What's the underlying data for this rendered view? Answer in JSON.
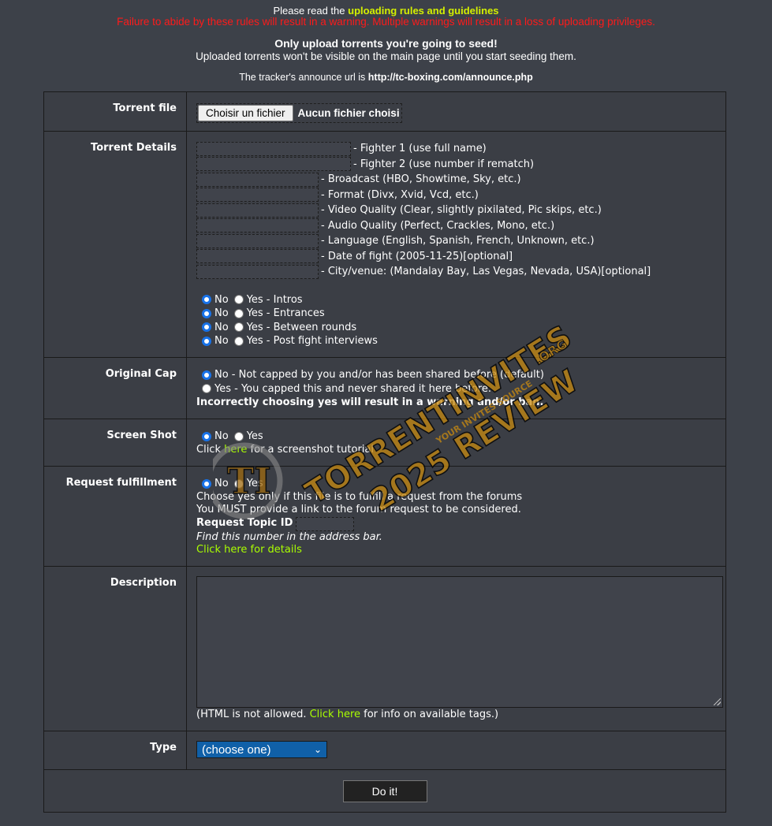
{
  "header": {
    "rules_prefix": "Please read the ",
    "rules_link": "uploading rules and guidelines",
    "warning": "Failure to abide by these rules will result in a warning. Multiple warnings will result in a loss of uploading privileges.",
    "seed_title": "Only upload torrents you're going to seed!",
    "seed_sub": "Uploaded torrents won't be visible on the main page until you start seeding them.",
    "announce_prefix": "The tracker's announce url is ",
    "announce_url": "http://tc-boxing.com/announce.php"
  },
  "torrent_file": {
    "label": "Torrent file",
    "button": "Choisir un fichier",
    "status": "Aucun fichier choisi"
  },
  "details": {
    "label": "Torrent Details",
    "fields": [
      "- Fighter 1 (use full name)",
      "- Fighter 2 (use number if rematch)",
      "- Broadcast (HBO, Showtime, Sky, etc.)",
      "- Format (Divx, Xvid, Vcd, etc.)",
      "- Video Quality (Clear, slightly pixilated, Pic skips, etc.)",
      "- Audio Quality (Perfect, Crackles, Mono, etc.)",
      "- Language (English, Spanish, French, Unknown, etc.)",
      "- Date of fight (2005-11-25)[optional]",
      "- City/venue: (Mandalay Bay, Las Vegas, Nevada, USA)[optional]"
    ],
    "no": "No",
    "yes_items": [
      "Yes - Intros",
      "Yes - Entrances",
      "Yes - Between rounds",
      "Yes - Post fight interviews"
    ]
  },
  "original_cap": {
    "label": "Original Cap",
    "no_text": "No - Not capped by you and/or has been shared before (default)",
    "yes_text": "Yes - You capped this and never shared it here before.",
    "note": "Incorrectly choosing yes will result in a warning and/or ban."
  },
  "screen_shot": {
    "label": "Screen Shot",
    "no": "No",
    "yes": "Yes",
    "click": "Click ",
    "here": "here",
    "rest": " for a screenshot tutorial"
  },
  "request": {
    "label": "Request fulfillment",
    "no": "No",
    "yes": "Yes",
    "line1": "Choose yes only if this file is to fulfill a request from the forums",
    "line2": "You MUST provide a link to the forum request to be considered.",
    "topic_label": "Request Topic ID",
    "hint": "Find this number in the address bar.",
    "details_link": "Click here for details"
  },
  "description": {
    "label": "Description",
    "note_prefix": "(HTML is not allowed. ",
    "note_link": "Click here",
    "note_suffix": " for info on available tags.)"
  },
  "type": {
    "label": "Type",
    "selected": "(choose one)"
  },
  "submit": "Do it!",
  "watermark": {
    "site": "TORRENTINVITES",
    "tld": ".ORG",
    "tagline": "YOUR INVITES SOURCE",
    "review": "2025 REVIEW",
    "logo": "TI"
  }
}
